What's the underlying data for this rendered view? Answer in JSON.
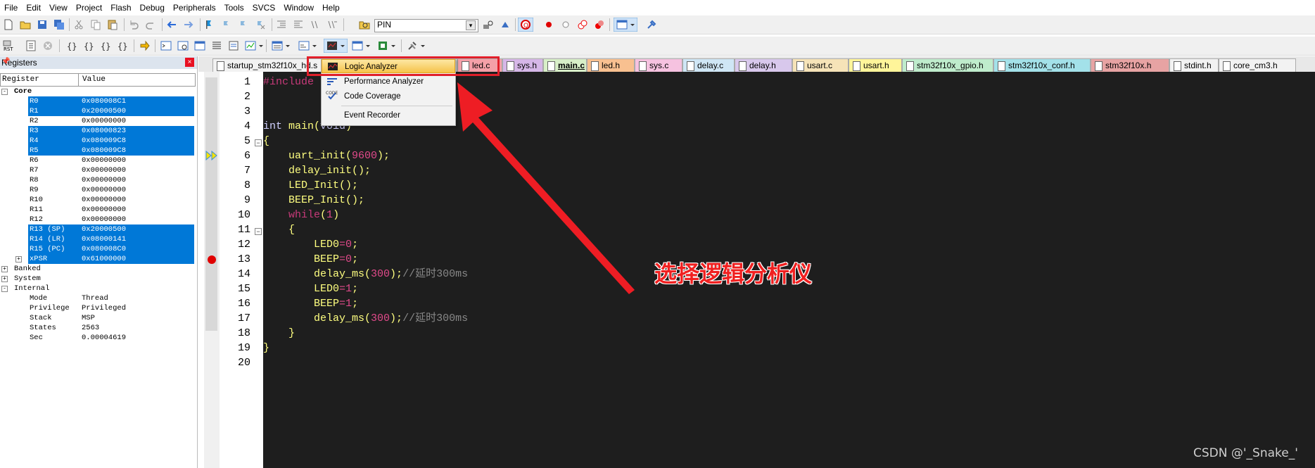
{
  "menu_bar": [
    "File",
    "Edit",
    "View",
    "Project",
    "Flash",
    "Debug",
    "Peripherals",
    "Tools",
    "SVCS",
    "Window",
    "Help"
  ],
  "toolbar": {
    "target_combo_value": "PIN"
  },
  "registers": {
    "title": "Registers",
    "col_register": "Register",
    "col_value": "Value",
    "groups": {
      "core": "Core",
      "banked": "Banked",
      "system": "System",
      "internal": "Internal"
    },
    "core_rows": [
      {
        "name": "R0",
        "value": "0x080008C1",
        "sel": true
      },
      {
        "name": "R1",
        "value": "0x20000500",
        "sel": true
      },
      {
        "name": "R2",
        "value": "0x00000000",
        "sel": false
      },
      {
        "name": "R3",
        "value": "0x08000823",
        "sel": true
      },
      {
        "name": "R4",
        "value": "0x080009C8",
        "sel": true
      },
      {
        "name": "R5",
        "value": "0x080009C8",
        "sel": true
      },
      {
        "name": "R6",
        "value": "0x00000000",
        "sel": false
      },
      {
        "name": "R7",
        "value": "0x00000000",
        "sel": false
      },
      {
        "name": "R8",
        "value": "0x00000000",
        "sel": false
      },
      {
        "name": "R9",
        "value": "0x00000000",
        "sel": false
      },
      {
        "name": "R10",
        "value": "0x00000000",
        "sel": false
      },
      {
        "name": "R11",
        "value": "0x00000000",
        "sel": false
      },
      {
        "name": "R12",
        "value": "0x00000000",
        "sel": false
      },
      {
        "name": "R13 (SP)",
        "value": "0x20000500",
        "sel": true
      },
      {
        "name": "R14 (LR)",
        "value": "0x08000141",
        "sel": true
      },
      {
        "name": "R15 (PC)",
        "value": "0x080008C0",
        "sel": true
      },
      {
        "name": "xPSR",
        "value": "0x61000000",
        "sel": true
      }
    ],
    "internal_rows": [
      {
        "name": "Mode",
        "value": "Thread"
      },
      {
        "name": "Privilege",
        "value": "Privileged"
      },
      {
        "name": "Stack",
        "value": "MSP"
      },
      {
        "name": "States",
        "value": "2563"
      },
      {
        "name": "Sec",
        "value": "0.00004619"
      }
    ]
  },
  "tabs": [
    {
      "label": "startup_stm32f10x_hd.s",
      "color": "#f2f2f2"
    },
    {
      "label": "led.c",
      "color": "#f4a0a8"
    },
    {
      "label": "sys.h",
      "color": "#d6b7e8"
    },
    {
      "label": "main.c",
      "color": "#d8efc8",
      "active": true
    },
    {
      "label": "led.h",
      "color": "#f8c090"
    },
    {
      "label": "sys.c",
      "color": "#f6c2e0"
    },
    {
      "label": "delay.c",
      "color": "#cfe6f5"
    },
    {
      "label": "delay.h",
      "color": "#d8c8ec"
    },
    {
      "label": "usart.c",
      "color": "#f6e3b8"
    },
    {
      "label": "usart.h",
      "color": "#fff59a"
    },
    {
      "label": "stm32f10x_gpio.h",
      "color": "#bfeccc"
    },
    {
      "label": "stm32f10x_conf.h",
      "color": "#a3e1e9"
    },
    {
      "label": "stm32f10x.h",
      "color": "#e7a3a3"
    },
    {
      "label": "stdint.h",
      "color": "#f2f2f2"
    },
    {
      "label": "core_cm3.h",
      "color": "#f2f2f2"
    }
  ],
  "dropdown": {
    "items": [
      "Logic Analyzer",
      "Performance Analyzer",
      "Code Coverage",
      "Event Recorder"
    ],
    "code_icon_text": "CODE"
  },
  "code": {
    "line_numbers": [
      "1",
      "2",
      "3",
      "4",
      "5",
      "6",
      "7",
      "8",
      "9",
      "10",
      "11",
      "12",
      "13",
      "14",
      "15",
      "16",
      "17",
      "18",
      "19",
      "20"
    ],
    "l1": "#include ",
    "l4_a": "int",
    "l4_b": " main(",
    "l4_c": "void",
    "l4_d": ")",
    "l5": "{",
    "l6_a": "    uart_init(",
    "l6_b": "9600",
    "l6_c": ");",
    "l7": "    delay_init();",
    "l8": "    LED_Init();",
    "l9": "    BEEP_Init();",
    "l10_a": "    ",
    "l10_b": "while",
    "l10_c": "(",
    "l10_d": "1",
    "l10_e": ")",
    "l11": "    {",
    "l12_a": "        LED0",
    "l12_b": "=",
    "l12_c": "0",
    "l12_d": ";",
    "l13_a": "        BEEP",
    "l13_b": "=",
    "l13_c": "0",
    "l13_d": ";",
    "l14_a": "        delay_ms(",
    "l14_b": "300",
    "l14_c": ");",
    "l14_d": "//延时300ms",
    "l15_a": "        LED0",
    "l15_b": "=",
    "l15_c": "1",
    "l15_d": ";",
    "l16_a": "        BEEP",
    "l16_b": "=",
    "l16_c": "1",
    "l16_d": ";",
    "l17_a": "        delay_ms(",
    "l17_b": "300",
    "l17_c": ");",
    "l17_d": "//延时300ms",
    "l18": "    }",
    "l19": "}"
  },
  "annotation": "选择逻辑分析仪",
  "watermark": "CSDN @'_Snake_'"
}
